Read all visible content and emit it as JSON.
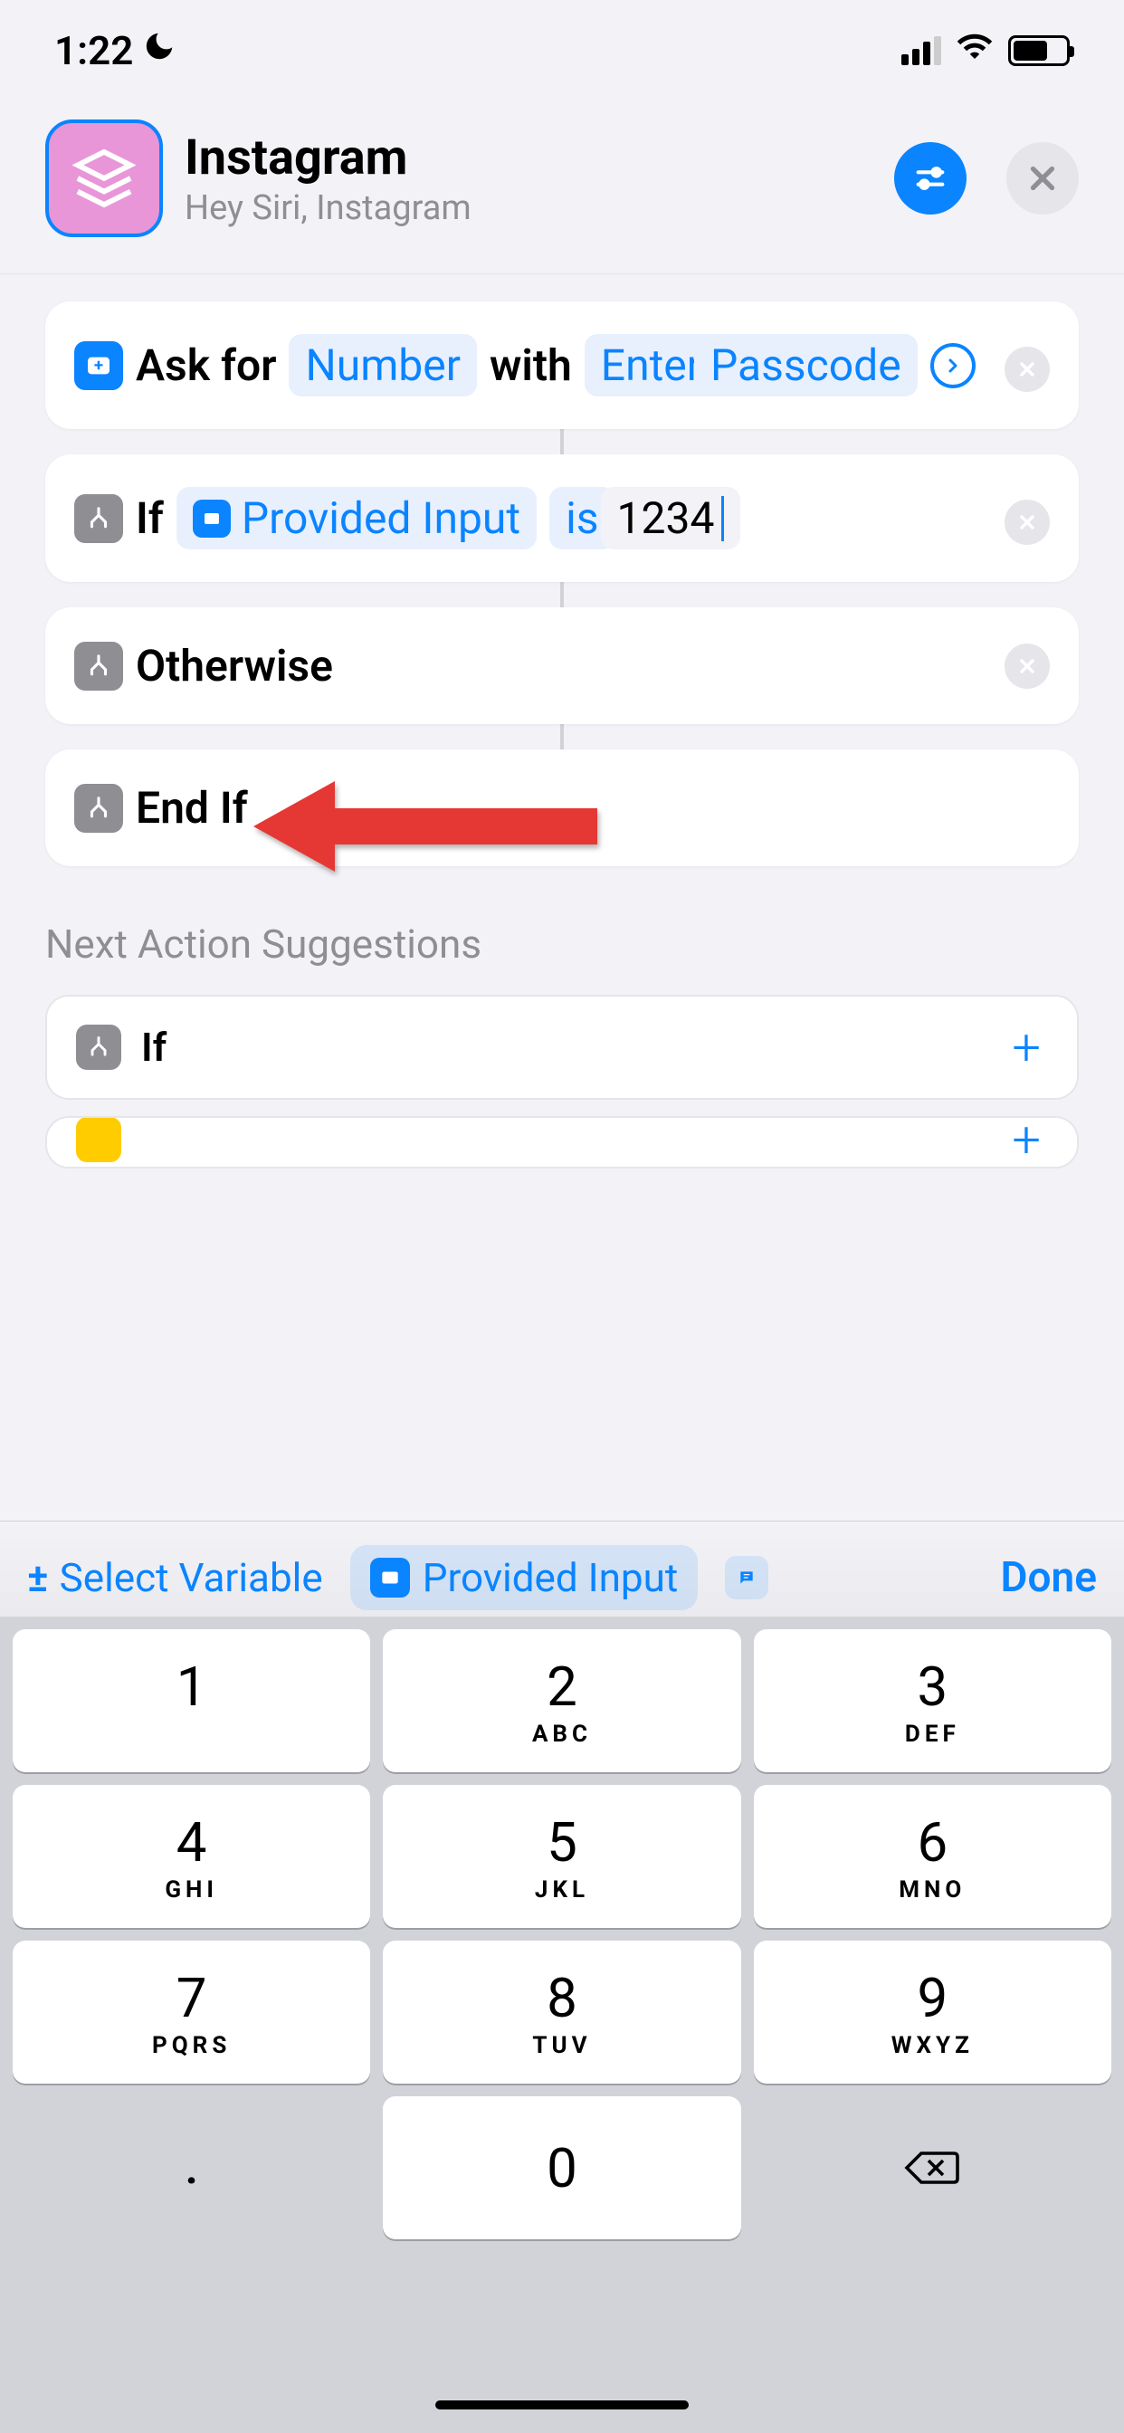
{
  "status": {
    "time": "1:22"
  },
  "header": {
    "title": "Instagram",
    "subtitle": "Hey Siri, Instagram"
  },
  "actions": {
    "ask": {
      "prefix": "Ask for",
      "type": "Number",
      "with": "with",
      "prompt_part1": "Enter",
      "prompt_part2": "Passcode"
    },
    "if": {
      "label": "If",
      "input": "Provided Input",
      "condition": "is",
      "value": "1234"
    },
    "otherwise": {
      "label": "Otherwise"
    },
    "endif": {
      "label": "End If"
    }
  },
  "suggestions": {
    "header": "Next Action Suggestions",
    "if_label": "If"
  },
  "varbar": {
    "select": "Select Variable",
    "provided": "Provided Input",
    "done": "Done"
  },
  "keypad": {
    "k1": "1",
    "k2": "2",
    "k3": "3",
    "k4": "4",
    "k5": "5",
    "k6": "6",
    "k7": "7",
    "k8": "8",
    "k9": "9",
    "k0": "0",
    "l2": "ABC",
    "l3": "DEF",
    "l4": "GHI",
    "l5": "JKL",
    "l6": "MNO",
    "l7": "PQRS",
    "l8": "TUV",
    "l9": "WXYZ",
    "dot": "."
  }
}
